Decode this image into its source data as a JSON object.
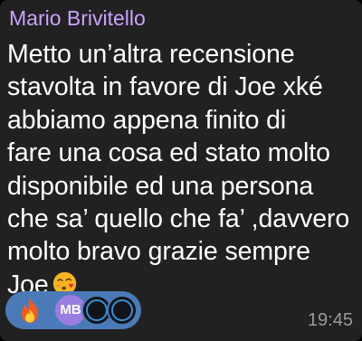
{
  "message": {
    "sender_name": "Mario Brivitello",
    "sender_color": "#c9a3ff",
    "lines": [
      "Metto un’altra recensione",
      "stavolta in favore di Joe xké",
      "abbiamo appena finito di",
      "fare una cosa ed stato molto",
      "disponibile ed una persona",
      "che sa’ quello che fa’ ,davvero",
      "molto bravo grazie sempre",
      "Joe"
    ],
    "trailing_emoji": "face-blowing-a-kiss-icon",
    "timestamp": "19:45"
  },
  "reactions": {
    "emoji": "fire-icon",
    "reactor_initials": "MB",
    "reactor_avatar_color": "#9a7de0",
    "pill_color": "#4b7ab9"
  },
  "colors": {
    "bubble_background": "#212121",
    "text": "#ffffff",
    "timestamp": "#9a9a9a"
  }
}
